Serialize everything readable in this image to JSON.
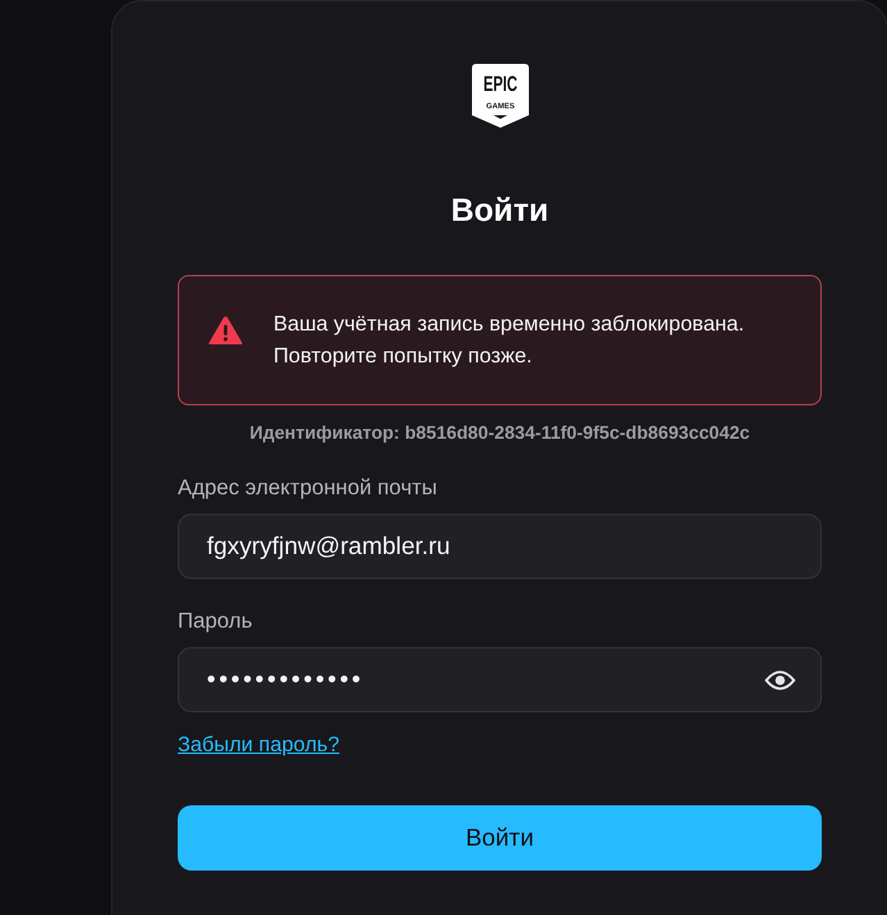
{
  "logo": {
    "line_1": "EPIC",
    "line_2": "GAMES"
  },
  "title": "Войти",
  "alert": {
    "kind": "error",
    "message": "Ваша учётная запись временно заблокирована. Повторите попытку позже."
  },
  "identifier": "Идентификатор: b8516d80-2834-11f0-9f5c-db8693cc042c",
  "fields": [
    {
      "kind": "text",
      "label": "Адрес электронной почты",
      "value": "fgxyryfjnw@rambler.ru"
    },
    {
      "kind": "password",
      "label": "Пароль",
      "value": "•••••••••••••"
    }
  ],
  "forgot_link": "Забыли пароль?",
  "submit_button": "Войти"
}
